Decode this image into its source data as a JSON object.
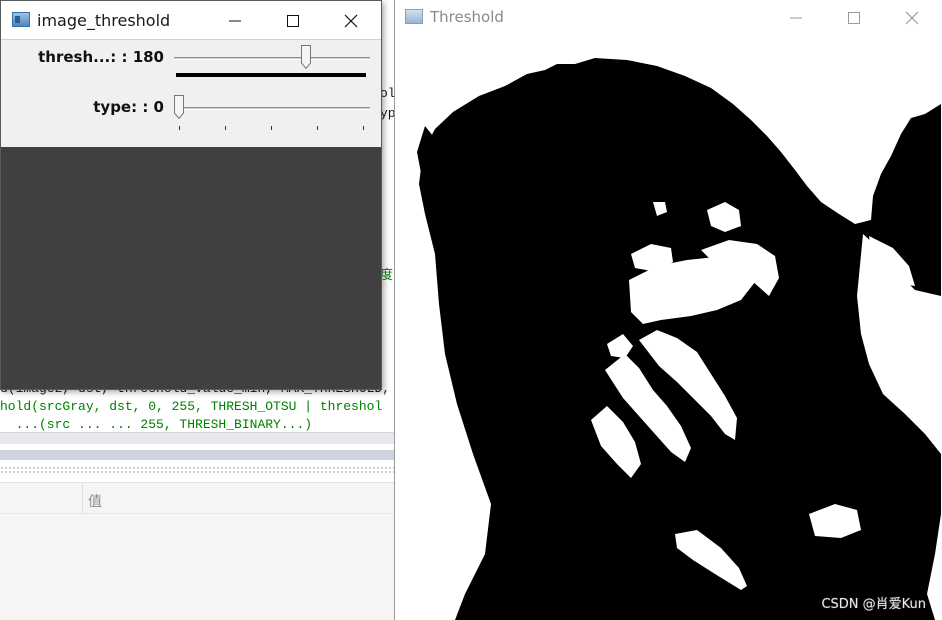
{
  "background_ide": {
    "right_code_fragments": [
      "ol",
      "yp"
    ],
    "chinese_fragment": "度",
    "code_lines": [
      {
        "text": "d(image2, dst, threshold_value_min, MAX_THRESHOLD,",
        "color": "black"
      },
      {
        "text": "hold(srcGray, dst, 0, 255, THRESH_OTSU | threshol",
        "color": "green"
      },
      {
        "text": "  ...(src ... ... 255, THRESH_BINARY...)",
        "color": "green"
      }
    ],
    "panel_header": "值"
  },
  "trackbar_window": {
    "title": "image_threshold",
    "icon": "opencv-window-icon",
    "controls": {
      "minimize": "minimize-icon",
      "maximize": "maximize-icon",
      "close": "close-icon"
    },
    "trackbars": [
      {
        "label": "thresh...: : 180",
        "value": 180,
        "max": 255,
        "focused": true
      },
      {
        "label": "type: : 0",
        "value": 0,
        "max": 4,
        "focused": false
      }
    ],
    "image_area_color": "#404040"
  },
  "threshold_window": {
    "title": "Threshold",
    "icon": "opencv-window-icon",
    "controls": {
      "minimize": "minimize-icon",
      "maximize": "maximize-icon",
      "close": "close-icon"
    },
    "image": "binary-threshold-portrait-image",
    "watermark": "CSDN @肖爱Kun"
  }
}
